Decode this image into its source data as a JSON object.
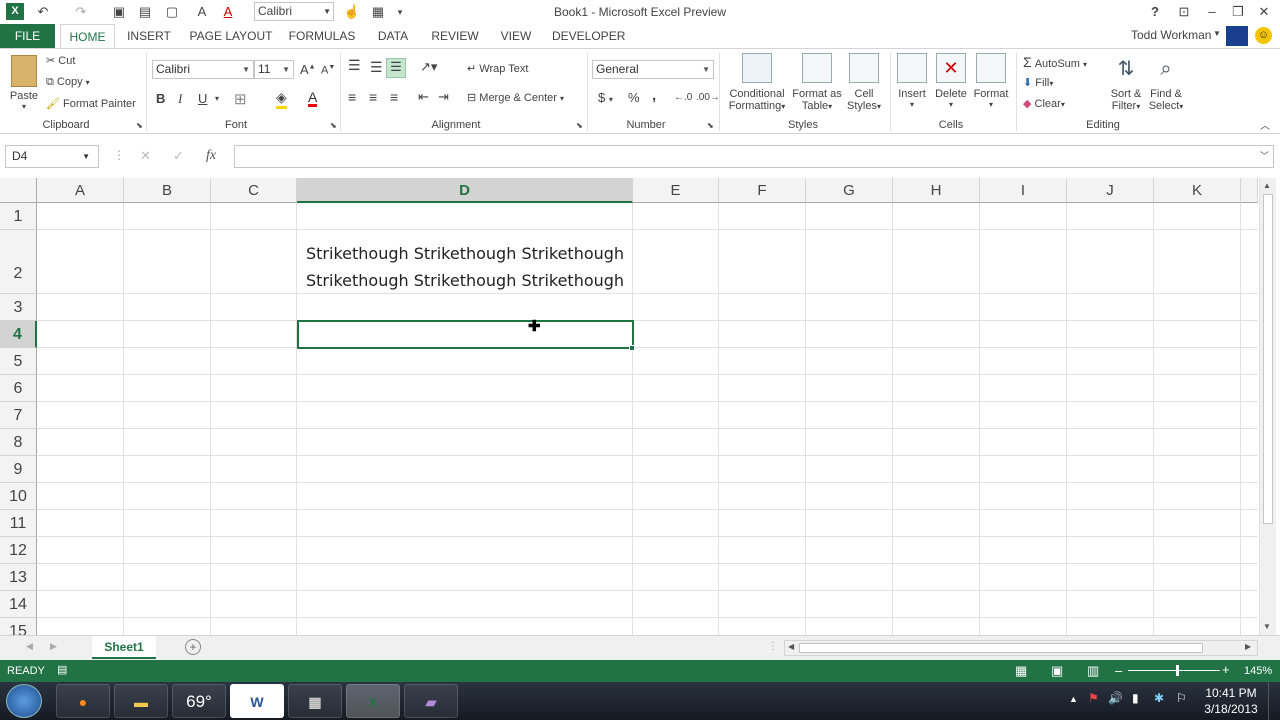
{
  "titlebar": {
    "title": "Book1 - Microsoft Excel Preview",
    "font_name": "Calibri",
    "help": "?",
    "user": "Todd Workman"
  },
  "tabs": [
    "FILE",
    "HOME",
    "INSERT",
    "PAGE LAYOUT",
    "FORMULAS",
    "DATA",
    "REVIEW",
    "VIEW",
    "DEVELOPER"
  ],
  "clipboard": {
    "paste": "Paste",
    "cut": "Cut",
    "copy": "Copy",
    "format_painter": "Format Painter",
    "label": "Clipboard"
  },
  "font": {
    "name": "Calibri",
    "size": "11",
    "bold": "B",
    "italic": "I",
    "underline": "U",
    "label": "Font"
  },
  "alignment": {
    "wrap": "Wrap Text",
    "merge": "Merge & Center",
    "label": "Alignment"
  },
  "number": {
    "format": "General",
    "currency": "$",
    "percent": "%",
    "comma": ",",
    "label": "Number"
  },
  "styles": {
    "conditional1": "Conditional",
    "conditional2": "Formatting",
    "format_as1": "Format as",
    "format_as2": "Table",
    "cell1": "Cell",
    "cell2": "Styles",
    "label": "Styles"
  },
  "cells": {
    "insert": "Insert",
    "delete": "Delete",
    "format": "Format",
    "label": "Cells"
  },
  "editing": {
    "autosum": "AutoSum",
    "fill": "Fill",
    "clear": "Clear",
    "sort1": "Sort &",
    "sort2": "Filter",
    "find1": "Find &",
    "find2": "Select",
    "label": "Editing"
  },
  "formula_bar": {
    "name_box": "D4",
    "fx": "fx",
    "cancel": "✕",
    "enter": "✓",
    "value": ""
  },
  "columns": [
    "A",
    "B",
    "C",
    "D",
    "E",
    "F",
    "G",
    "H",
    "I",
    "J",
    "K"
  ],
  "rows": [
    "1",
    "2",
    "3",
    "4",
    "5",
    "6",
    "7",
    "8",
    "9",
    "10",
    "11",
    "12",
    "13",
    "14",
    "15"
  ],
  "cell_d2": {
    "line1": "Strikethough Strikethough Strikethough",
    "line2": "Strikethough Strikethough Strikethough"
  },
  "sheet_tab": "Sheet1",
  "status": {
    "state": "READY",
    "zoom": "145%"
  },
  "taskbar": {
    "temp": "69°",
    "time": "10:41 PM",
    "date": "3/18/2013"
  },
  "colors": {
    "accent": "#217346"
  }
}
